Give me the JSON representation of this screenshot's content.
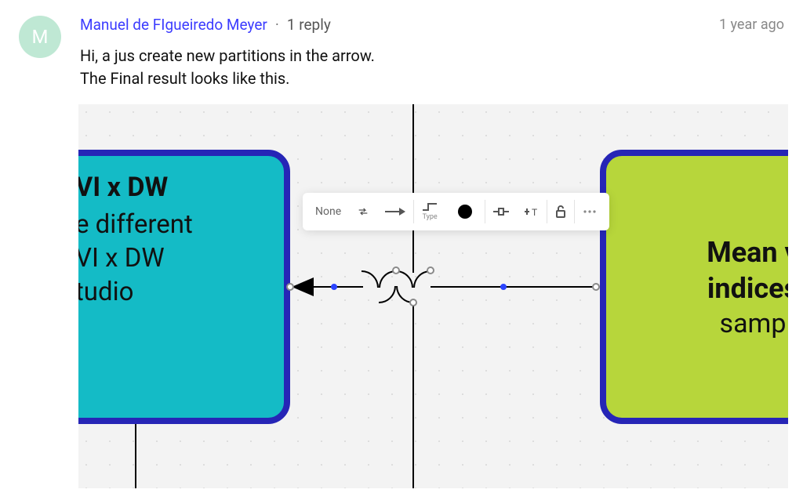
{
  "post": {
    "avatar_initial": "M",
    "author": "Manuel de FIgueiredo Meyer",
    "reply_count": "1 reply",
    "timestamp": "1 year ago",
    "body_line1": "Hi, a jus create new partitions in the arrow.",
    "body_line2": "The Final result looks like this."
  },
  "canvas": {
    "left_shape": {
      "line1": "VI x DW",
      "line2": "e different",
      "line3": "VI x DW",
      "line4": "tudio"
    },
    "right_shape": {
      "line1": "Mean v",
      "line2": "indices",
      "line3": "samp"
    },
    "toolbar": {
      "none_label": "None",
      "type_label": "Type"
    }
  }
}
